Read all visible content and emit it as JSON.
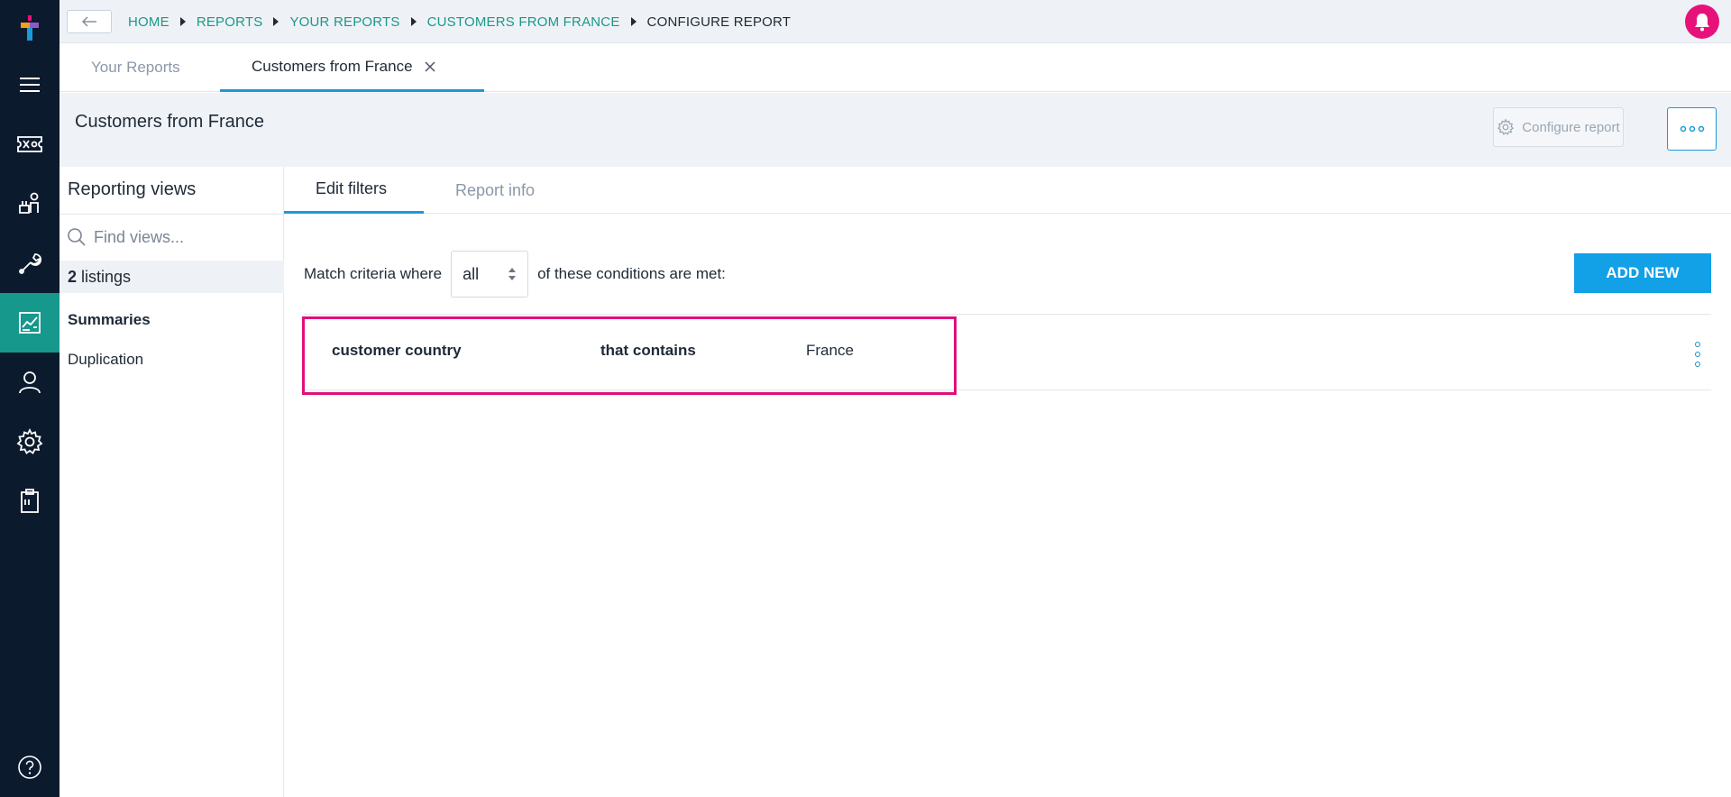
{
  "breadcrumb": {
    "items": [
      "HOME",
      "REPORTS",
      "YOUR REPORTS",
      "CUSTOMERS FROM FRANCE"
    ],
    "current": "CONFIGURE REPORT"
  },
  "tabs": [
    {
      "label": "Your Reports",
      "active": false
    },
    {
      "label": "Customers from France",
      "active": true
    }
  ],
  "header": {
    "title": "Customers from France",
    "configure_label": "Configure report"
  },
  "sidepanel": {
    "title": "Reporting views",
    "search_placeholder": "Find views...",
    "listings_count": "2",
    "listings_label": "listings",
    "section": "Summaries",
    "items": [
      "Duplication"
    ]
  },
  "subtabs": [
    {
      "label": "Edit filters",
      "active": true
    },
    {
      "label": "Report info",
      "active": false
    }
  ],
  "criteria": {
    "prefix": "Match criteria where",
    "select_value": "all",
    "suffix": "of these conditions are met:",
    "add_label": "ADD NEW"
  },
  "condition": {
    "field": "customer country",
    "operator": "that contains",
    "value": "France"
  },
  "icons": {
    "rail": [
      "logo",
      "menu-icon",
      "ticket-icon",
      "plant-icon",
      "wrench-icon",
      "report-icon",
      "user-icon",
      "settings-icon",
      "clipboard-icon",
      "help-icon"
    ]
  },
  "colors": {
    "rail_bg": "#0c1a2d",
    "rail_active": "#16988c",
    "link": "#1a9889",
    "accent_blue": "#12a0e6",
    "highlight_pink": "#e0107a"
  }
}
